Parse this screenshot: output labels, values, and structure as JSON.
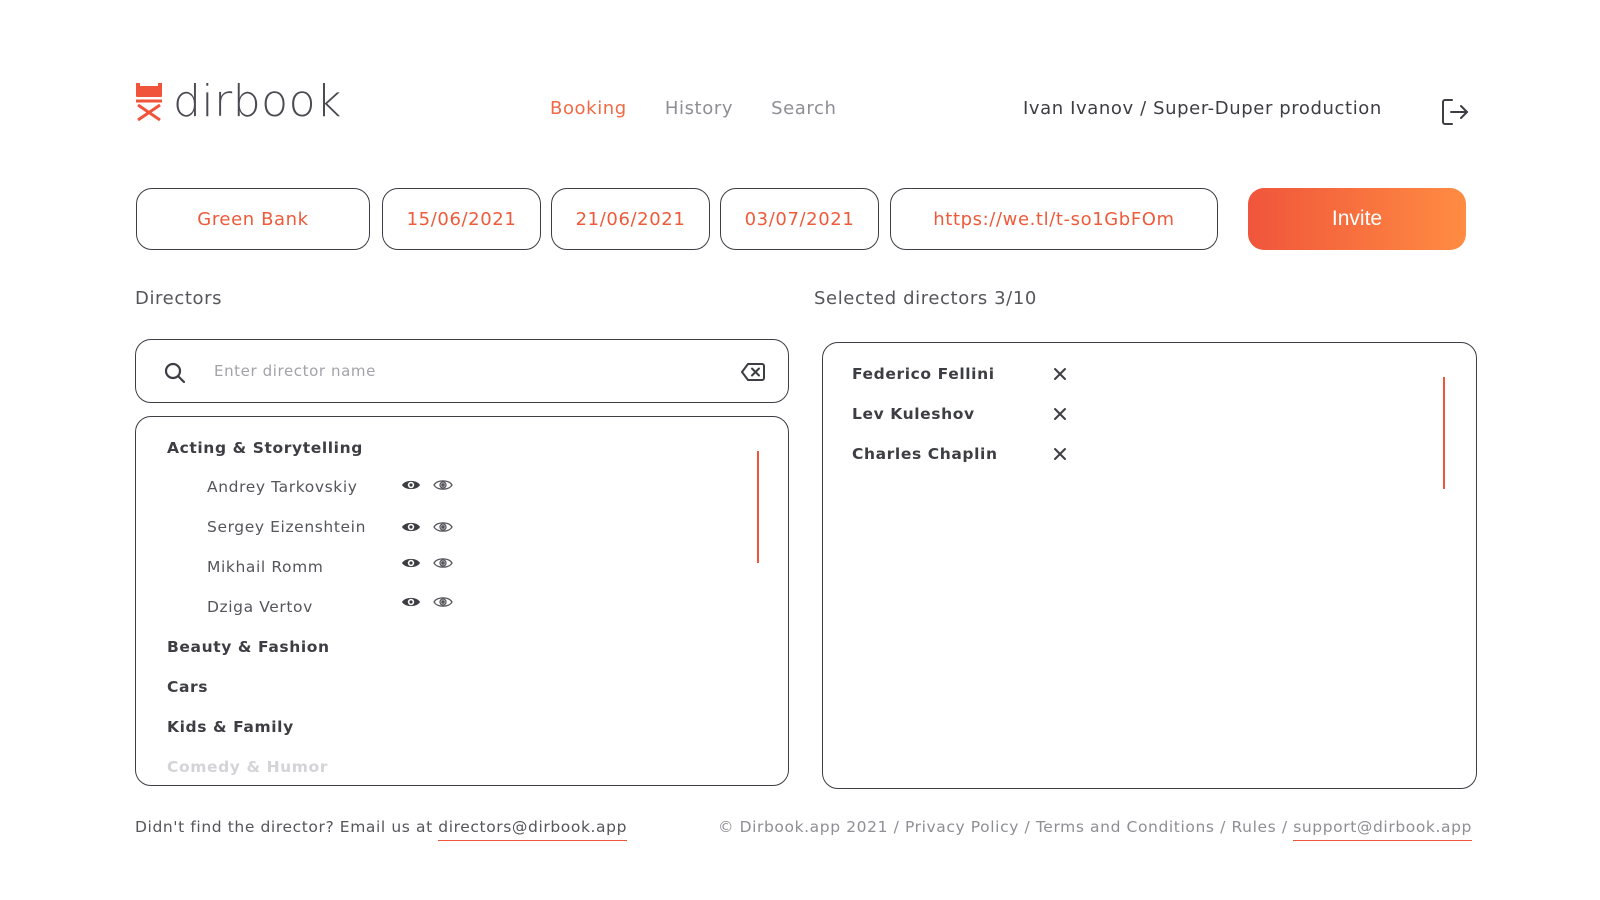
{
  "app": {
    "logo_text": "dirbook"
  },
  "nav": {
    "booking": "Booking",
    "history": "History",
    "search": "Search"
  },
  "user": {
    "label": "Ivan Ivanov / Super-Duper production"
  },
  "booking_fields": {
    "client": "Green Bank",
    "date1": "15/06/2021",
    "date2": "21/06/2021",
    "date3": "03/07/2021",
    "link": "https://we.tl/t-so1GbFOm",
    "invite_label": "Invite"
  },
  "directors": {
    "title": "Directors",
    "search_placeholder": "Enter director name",
    "search_value": "",
    "categories": [
      {
        "name": "Acting & Storytelling",
        "directors": [
          "Andrey Tarkovskiy",
          "Sergey Eizenshtein",
          "Mikhail Romm",
          "Dziga Vertov"
        ]
      },
      {
        "name": "Beauty & Fashion"
      },
      {
        "name": "Cars"
      },
      {
        "name": "Kids & Family"
      },
      {
        "name": "Comedy & Humor"
      }
    ]
  },
  "selected": {
    "title": "Selected directors 3/10",
    "items": [
      "Federico Fellini",
      "Lev Kuleshov",
      "Charles Chaplin"
    ]
  },
  "footer": {
    "left_text": "Didn't find the director? Email us at ",
    "directors_email": "directors@dirbook.app",
    "copyright": "© Dirbook.app 2021",
    "sep": " / ",
    "privacy": "Privacy Policy",
    "terms": "Terms and Conditions",
    "rules": "Rules",
    "support_email": "support@dirbook.app"
  },
  "colors": {
    "accent": "#f0553b",
    "accent_end": "#ff8c42",
    "text": "#3d3d44",
    "muted": "#8e8e96"
  }
}
